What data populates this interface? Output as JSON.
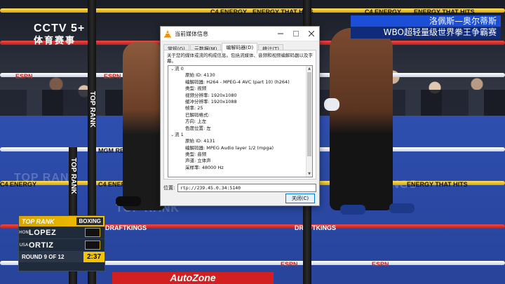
{
  "broadcast": {
    "channel_logo": "CCTV 5+",
    "channel_sub": "体育赛事",
    "title_line1": "洛佩斯—奥尔蒂斯",
    "title_line2": "WBO超轻量级世界拳王争霸赛",
    "board_texts": [
      "C4 ENERGY",
      "ENERGY THAT HITS",
      "ESPN",
      "MGM REWARDS",
      "DRAFTKINGS",
      "TOP RANK",
      "AutoZone"
    ]
  },
  "scorebug": {
    "brand": "TOP RANK",
    "sport": "BOXING",
    "fighters": [
      {
        "flag": "HON",
        "name": "LOPEZ"
      },
      {
        "flag": "USA",
        "name": "ORTIZ"
      }
    ],
    "round_text": "ROUND 9 OF 12",
    "clock": "2:37"
  },
  "dialog": {
    "title": "当前媒体信息",
    "tabs": [
      "常规(G)",
      "元数据(M)",
      "编解码器(D)",
      "统计(T)"
    ],
    "active_tab_index": 2,
    "description": "关于您的媒体或流的构成信息。包括流媒体、音频和视频编解码器以及字幕。",
    "streams": [
      {
        "label": "流 0",
        "props": [
          "原始 ID: 4130",
          "编解码器: H264 - MPEG-4 AVC (part 10) (h264)",
          "类型: 视频",
          "视频分辨率: 1920x1080",
          "缓冲分辨率: 1920x1088",
          "帧率: 25",
          "已解码格式:",
          "方向: 上左",
          "色度位置: 左"
        ]
      },
      {
        "label": "流 1",
        "props": [
          "原始 ID: 4131",
          "编解码器: MPEG Audio layer 1/2 (mpga)",
          "类型: 音频",
          "声道: 立体声",
          "采样率: 48000 Hz"
        ]
      }
    ],
    "location_label": "位置:",
    "location_value": "rtp://239.45.0.34:5140",
    "close_label": "关闭(C)",
    "colors": {
      "accent": "#0078d7",
      "vlc_orange": "#f39200"
    }
  }
}
